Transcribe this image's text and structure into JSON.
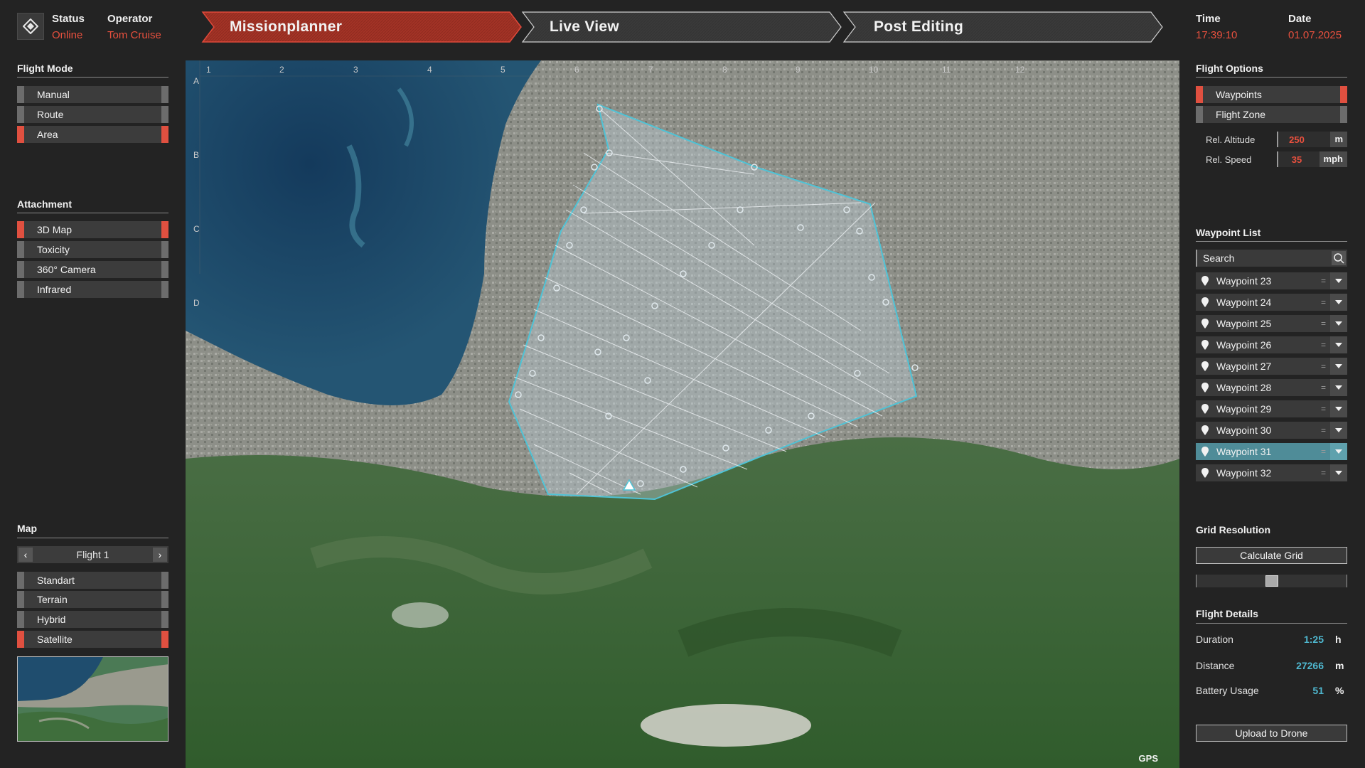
{
  "header": {
    "status_label": "Status",
    "status_value": "Online",
    "operator_label": "Operator",
    "operator_value": "Tom Cruise",
    "time_label": "Time",
    "time_value": "17:39:10",
    "date_label": "Date",
    "date_value": "01.07.2025",
    "tabs": [
      {
        "label": "Missionplanner",
        "active": true
      },
      {
        "label": "Live View",
        "active": false
      },
      {
        "label": "Post Editing",
        "active": false
      }
    ]
  },
  "left": {
    "flight_mode": {
      "title": "Flight Mode",
      "options": [
        {
          "label": "Manual",
          "active": false
        },
        {
          "label": "Route",
          "active": false
        },
        {
          "label": "Area",
          "active": true
        }
      ]
    },
    "attachment": {
      "title": "Attachment",
      "options": [
        {
          "label": "3D Map",
          "active": true
        },
        {
          "label": "Toxicity",
          "active": false
        },
        {
          "label": "360° Camera",
          "active": false
        },
        {
          "label": "Infrared",
          "active": false
        }
      ]
    },
    "map": {
      "title": "Map",
      "flight_selector": "Flight 1",
      "options": [
        {
          "label": "Standart",
          "active": false
        },
        {
          "label": "Terrain",
          "active": false
        },
        {
          "label": "Hybrid",
          "active": false
        },
        {
          "label": "Satellite",
          "active": true
        }
      ]
    }
  },
  "map_view": {
    "grid_columns": [
      "1",
      "2",
      "3",
      "4",
      "5",
      "6",
      "7",
      "8",
      "9",
      "10",
      "11",
      "12"
    ],
    "grid_rows": [
      "A",
      "B",
      "C",
      "D"
    ],
    "gps_label": "GPS",
    "polygon_color": "#4fc3d6"
  },
  "right": {
    "flight_options": {
      "title": "Flight Options",
      "options": [
        {
          "label": "Waypoints",
          "active": true
        },
        {
          "label": "Flight Zone",
          "active": false
        }
      ],
      "params": [
        {
          "label": "Rel. Altitude",
          "value": "250",
          "unit": "m"
        },
        {
          "label": "Rel. Speed",
          "value": "35",
          "unit": "mph"
        }
      ]
    },
    "waypoint_list": {
      "title": "Waypoint List",
      "search_value": "Search",
      "items": [
        {
          "label": "Waypoint 23",
          "selected": false
        },
        {
          "label": "Waypoint 24",
          "selected": false
        },
        {
          "label": "Waypoint 25",
          "selected": false
        },
        {
          "label": "Waypoint 26",
          "selected": false
        },
        {
          "label": "Waypoint 27",
          "selected": false
        },
        {
          "label": "Waypoint 28",
          "selected": false
        },
        {
          "label": "Waypoint 29",
          "selected": false
        },
        {
          "label": "Waypoint 30",
          "selected": false
        },
        {
          "label": "Waypoint 31",
          "selected": true
        },
        {
          "label": "Waypoint 32",
          "selected": false
        }
      ]
    },
    "grid_resolution": {
      "title": "Grid Resolution",
      "button": "Calculate Grid",
      "slider_value": 0.5
    },
    "flight_details": {
      "title": "Flight Details",
      "rows": [
        {
          "label": "Duration",
          "value": "1:25",
          "unit": "h"
        },
        {
          "label": "Distance",
          "value": "27266",
          "unit": "m"
        },
        {
          "label": "Battery Usage",
          "value": "51",
          "unit": "%"
        }
      ]
    },
    "upload_button": "Upload to Drone"
  },
  "colors": {
    "accent": "#e05040",
    "selection": "#4f8c98",
    "info_value": "#4fb8d0"
  }
}
